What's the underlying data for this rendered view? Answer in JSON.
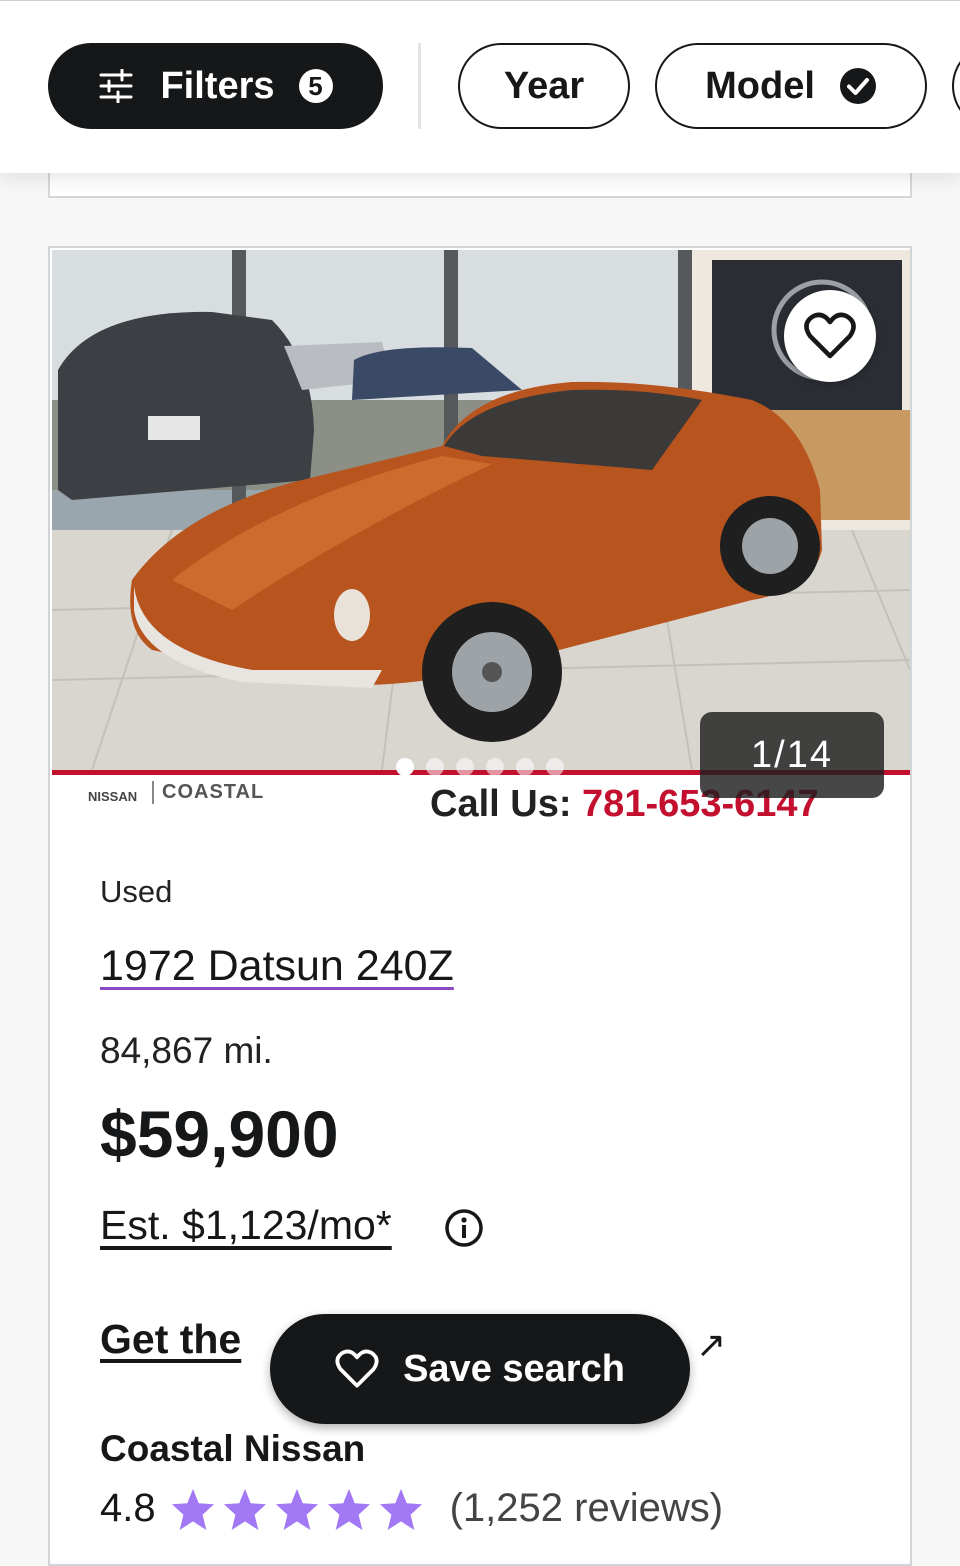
{
  "filters": {
    "filters_label": "Filters",
    "filters_count": "5",
    "year_label": "Year",
    "model_label": "Model"
  },
  "listing": {
    "photo": {
      "counter": "1/14",
      "banner_brand": "NISSAN",
      "banner_dealer": "COASTAL",
      "banner_call": "Call Us:",
      "banner_phone": "781-653-6147",
      "dot_count": 6,
      "active_dot": 1
    },
    "condition": "Used",
    "title": "1972 Datsun 240Z",
    "mileage": "84,867 mi.",
    "price": "$59,900",
    "estimate": "Est. $1,123/mo*",
    "cta_partial": "Get the",
    "dealer_name": "Coastal Nissan",
    "rating": "4.8",
    "rating_stars": 5,
    "reviews": "(1,252 reviews)"
  },
  "save_search": {
    "label": "Save search"
  },
  "colors": {
    "primary_dark": "#161718",
    "star": "#a278f4",
    "link_underline": "#8a49c2",
    "banner_red": "#c3102f"
  }
}
